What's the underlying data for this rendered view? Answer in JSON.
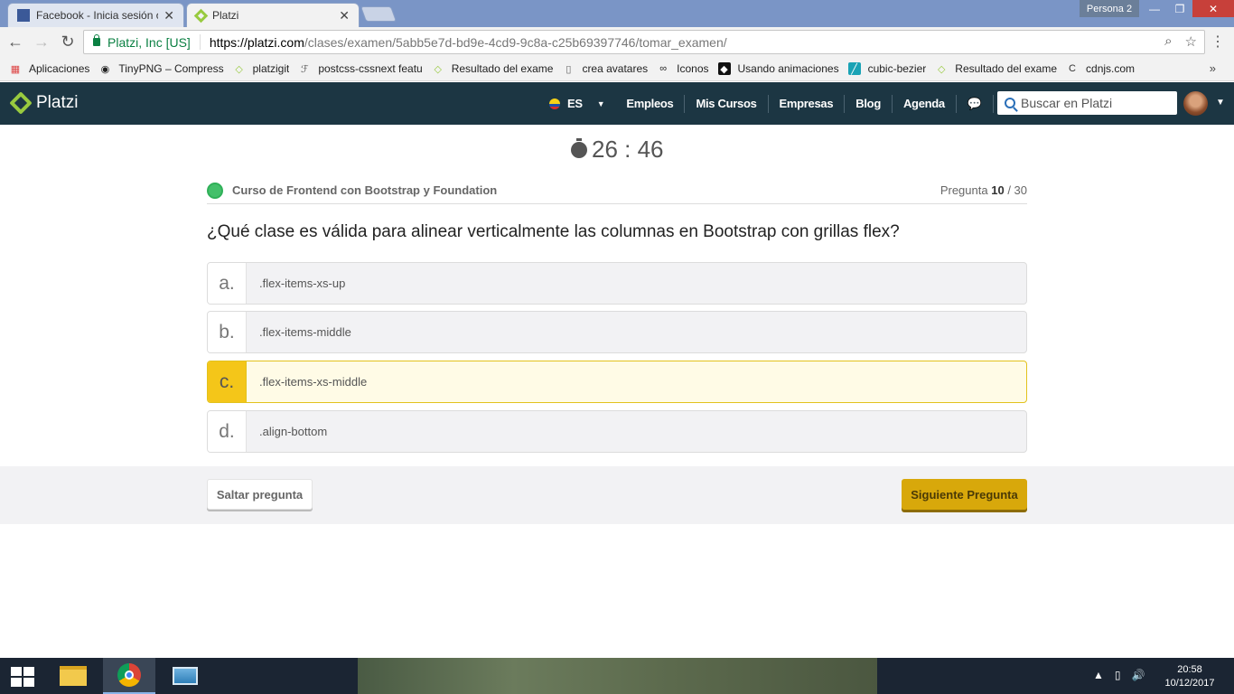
{
  "browser": {
    "tabs": [
      {
        "title": "Facebook - Inicia sesión o",
        "close": "✕"
      },
      {
        "title": "Platzi",
        "close": "✕"
      }
    ],
    "profile_label": "Persona 2",
    "window_controls": {
      "minimize": "—",
      "maximize": "❐",
      "close": "✕"
    },
    "address": {
      "secure_label": "Platzi, Inc [US]",
      "url_host": "https://platzi.com",
      "url_path": "/clases/examen/5abb5e7d-bd9e-4cd9-9c8a-c25b69397746/tomar_examen/"
    },
    "bookmarks": [
      {
        "label": "Aplicaciones",
        "icon": "apps-grid-icon"
      },
      {
        "label": "TinyPNG – Compress",
        "icon": "panda-icon"
      },
      {
        "label": "platzigit",
        "icon": "platzi-icon"
      },
      {
        "label": "postcss-cssnext featu",
        "icon": "postcss-icon"
      },
      {
        "label": "Resultado del exame",
        "icon": "platzi-icon"
      },
      {
        "label": "crea avatares",
        "icon": "page-icon"
      },
      {
        "label": "Iconos",
        "icon": "binoculars-icon"
      },
      {
        "label": "Usando animaciones",
        "icon": "mdn-icon"
      },
      {
        "label": "cubic-bezier",
        "icon": "curve-icon"
      },
      {
        "label": "Resultado del exame",
        "icon": "platzi-icon"
      },
      {
        "label": "cdnjs.com",
        "icon": "cdnjs-icon"
      }
    ],
    "bookmarks_more": "»"
  },
  "platzi_header": {
    "logo_text": "Platzi",
    "language": "ES",
    "nav": [
      "Empleos",
      "Mis Cursos",
      "Empresas",
      "Blog",
      "Agenda"
    ],
    "search_placeholder": "Buscar en Platzi"
  },
  "exam": {
    "timer": "26 : 46",
    "course_title": "Curso de Frontend con Bootstrap y Foundation",
    "question_label": "Pregunta",
    "question_current": "10",
    "question_total": "/ 30",
    "question_text": "¿Qué clase es válida para alinear verticalmente las columnas en Bootstrap con grillas flex?",
    "options": [
      {
        "letter": "a.",
        "text": ".flex-items-xs-up",
        "selected": false
      },
      {
        "letter": "b.",
        "text": ".flex-items-middle",
        "selected": false
      },
      {
        "letter": "c.",
        "text": ".flex-items-xs-middle",
        "selected": true
      },
      {
        "letter": "d.",
        "text": ".align-bottom",
        "selected": false
      }
    ],
    "skip_label": "Saltar pregunta",
    "next_label": "Siguiente Pregunta"
  },
  "taskbar": {
    "time": "20:58",
    "date": "10/12/2017"
  },
  "colors": {
    "header_bg": "#1c3643",
    "accent_yellow": "#f4c619",
    "next_button": "#d8a80b",
    "platzi_green": "#98ca3f"
  }
}
